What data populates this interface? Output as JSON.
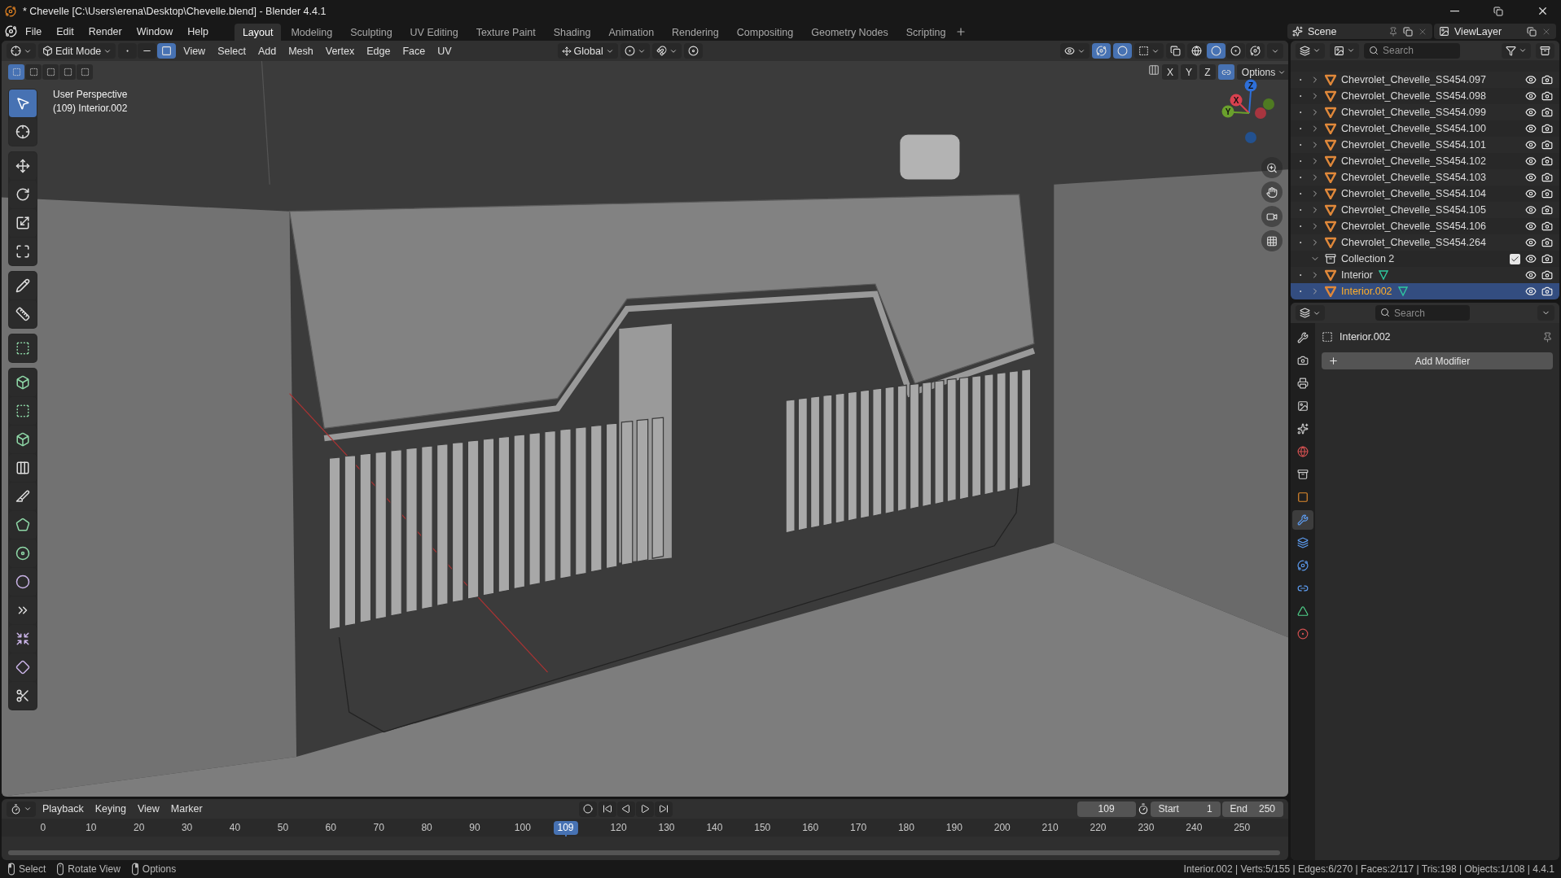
{
  "title_bar": {
    "title": "* Chevelle [C:\\Users\\erena\\Desktop\\Chevelle.blend] - Blender 4.4.1"
  },
  "menu": [
    "File",
    "Edit",
    "Render",
    "Window",
    "Help"
  ],
  "workspaces": [
    {
      "label": "Layout",
      "selected": true
    },
    {
      "label": "Modeling",
      "selected": false
    },
    {
      "label": "Sculpting",
      "selected": false
    },
    {
      "label": "UV Editing",
      "selected": false
    },
    {
      "label": "Texture Paint",
      "selected": false
    },
    {
      "label": "Shading",
      "selected": false
    },
    {
      "label": "Animation",
      "selected": false
    },
    {
      "label": "Rendering",
      "selected": false
    },
    {
      "label": "Compositing",
      "selected": false
    },
    {
      "label": "Geometry Nodes",
      "selected": false
    },
    {
      "label": "Scripting",
      "selected": false
    }
  ],
  "scene": {
    "name": "Scene"
  },
  "view_layer": {
    "name": "ViewLayer"
  },
  "viewport_header": {
    "mode": "Edit Mode",
    "select_modes": [
      {
        "kind": "vertex",
        "selected": false
      },
      {
        "kind": "edge",
        "selected": false
      },
      {
        "kind": "face",
        "selected": true
      }
    ],
    "menus": [
      "View",
      "Select",
      "Add",
      "Mesh",
      "Vertex",
      "Edge",
      "Face",
      "UV"
    ],
    "orientation": "Global",
    "shading_modes": [
      {
        "kind": "wireframe",
        "selected": false
      },
      {
        "kind": "solid",
        "selected": true
      },
      {
        "kind": "material",
        "selected": false
      },
      {
        "kind": "rendered",
        "selected": false
      }
    ],
    "mirror_axes": [
      "X",
      "Y",
      "Z"
    ],
    "options": "Options"
  },
  "viewport": {
    "perspective": "User Perspective",
    "active_object": "(109) Interior.002",
    "box_modes": [
      {
        "selected": true
      },
      {
        "selected": false
      },
      {
        "selected": false
      },
      {
        "selected": false
      },
      {
        "selected": false
      }
    ],
    "gizmo_axes": [
      {
        "label": "Z",
        "color": "#2e6fd8"
      },
      {
        "label": "X",
        "color": "#d9414f"
      },
      {
        "label": "Y",
        "color": "#6aa02c"
      }
    ]
  },
  "tool_groups": [
    {
      "tools": [
        {
          "kind": "select",
          "selected": true
        },
        {
          "kind": "cursor",
          "selected": false
        }
      ]
    },
    {
      "tools": [
        {
          "kind": "move",
          "selected": false
        },
        {
          "kind": "rotate",
          "selected": false
        },
        {
          "kind": "scale",
          "selected": false
        },
        {
          "kind": "transform",
          "selected": false
        }
      ]
    },
    {
      "tools": [
        {
          "kind": "annotate",
          "selected": false
        },
        {
          "kind": "measure",
          "selected": false
        }
      ]
    },
    {
      "tools": [
        {
          "kind": "add-cube",
          "selected": false
        }
      ]
    },
    {
      "tools": [
        {
          "kind": "extrude",
          "selected": false
        },
        {
          "kind": "inset",
          "selected": false
        },
        {
          "kind": "bevel",
          "selected": false
        },
        {
          "kind": "loop-cut",
          "selected": false
        },
        {
          "kind": "knife",
          "selected": false
        },
        {
          "kind": "poly-build",
          "selected": false
        },
        {
          "kind": "spin",
          "selected": false
        },
        {
          "kind": "smooth",
          "selected": false
        },
        {
          "kind": "edge-slide",
          "selected": false
        },
        {
          "kind": "shrink",
          "selected": false
        },
        {
          "kind": "shear",
          "selected": false
        },
        {
          "kind": "rip",
          "selected": false
        }
      ]
    }
  ],
  "outliner": {
    "search": {
      "placeholder": "Search"
    },
    "objects": [
      {
        "name": "Chevrolet_Chevelle_SS454.097",
        "selected": false,
        "mesh_data": false
      },
      {
        "name": "Chevrolet_Chevelle_SS454.098",
        "selected": false,
        "mesh_data": false
      },
      {
        "name": "Chevrolet_Chevelle_SS454.099",
        "selected": false,
        "mesh_data": false
      },
      {
        "name": "Chevrolet_Chevelle_SS454.100",
        "selected": false,
        "mesh_data": false
      },
      {
        "name": "Chevrolet_Chevelle_SS454.101",
        "selected": false,
        "mesh_data": false
      },
      {
        "name": "Chevrolet_Chevelle_SS454.102",
        "selected": false,
        "mesh_data": false
      },
      {
        "name": "Chevrolet_Chevelle_SS454.103",
        "selected": false,
        "mesh_data": false
      },
      {
        "name": "Chevrolet_Chevelle_SS454.104",
        "selected": false,
        "mesh_data": false
      },
      {
        "name": "Chevrolet_Chevelle_SS454.105",
        "selected": false,
        "mesh_data": false
      },
      {
        "name": "Chevrolet_Chevelle_SS454.106",
        "selected": false,
        "mesh_data": false
      },
      {
        "name": "Chevrolet_Chevelle_SS454.264",
        "selected": false,
        "mesh_data": false
      }
    ],
    "collection": {
      "name": "Collection 2",
      "expanded": true,
      "checked": true,
      "children": [
        {
          "name": "Interior",
          "selected": false,
          "mesh_data": true
        },
        {
          "name": "Interior.002",
          "selected": true,
          "mesh_data": true
        }
      ]
    }
  },
  "properties": {
    "search": {
      "placeholder": "Search"
    },
    "tabs": [
      {
        "kind": "tool",
        "selected": false
      },
      {
        "kind": "render",
        "selected": false
      },
      {
        "kind": "output",
        "selected": false
      },
      {
        "kind": "view-layer",
        "selected": false
      },
      {
        "kind": "scene",
        "selected": false
      },
      {
        "kind": "world",
        "selected": false
      },
      {
        "kind": "collection",
        "selected": false
      },
      {
        "kind": "object",
        "selected": false
      },
      {
        "kind": "modifiers",
        "selected": true
      },
      {
        "kind": "particles",
        "selected": false
      },
      {
        "kind": "physics",
        "selected": false
      },
      {
        "kind": "constraints",
        "selected": false
      },
      {
        "kind": "data",
        "selected": false
      },
      {
        "kind": "material",
        "selected": false
      }
    ],
    "object": "Interior.002",
    "add_modifier": "Add Modifier"
  },
  "timeline": {
    "menus": [
      "Playback",
      "Keying",
      "View",
      "Marker"
    ],
    "current_frame": "109",
    "start_label": "Start",
    "start": "1",
    "end_label": "End",
    "end": "250",
    "ticks": [
      "0",
      "10",
      "20",
      "30",
      "40",
      "50",
      "60",
      "70",
      "80",
      "90",
      "100",
      "120",
      "130",
      "140",
      "150",
      "160",
      "170",
      "180",
      "190",
      "200",
      "210",
      "220",
      "230",
      "240",
      "250"
    ],
    "playhead": "109"
  },
  "status_bar": {
    "hints": [
      {
        "kind": "left",
        "label": "Select"
      },
      {
        "kind": "middle",
        "label": "Rotate View"
      },
      {
        "kind": "right",
        "label": "Options"
      }
    ],
    "stats": "Interior.002 | Verts:5/155 | Edges:6/270 | Faces:2/117 | Tris:198 | Objects:1/108 | 4.4.1"
  }
}
